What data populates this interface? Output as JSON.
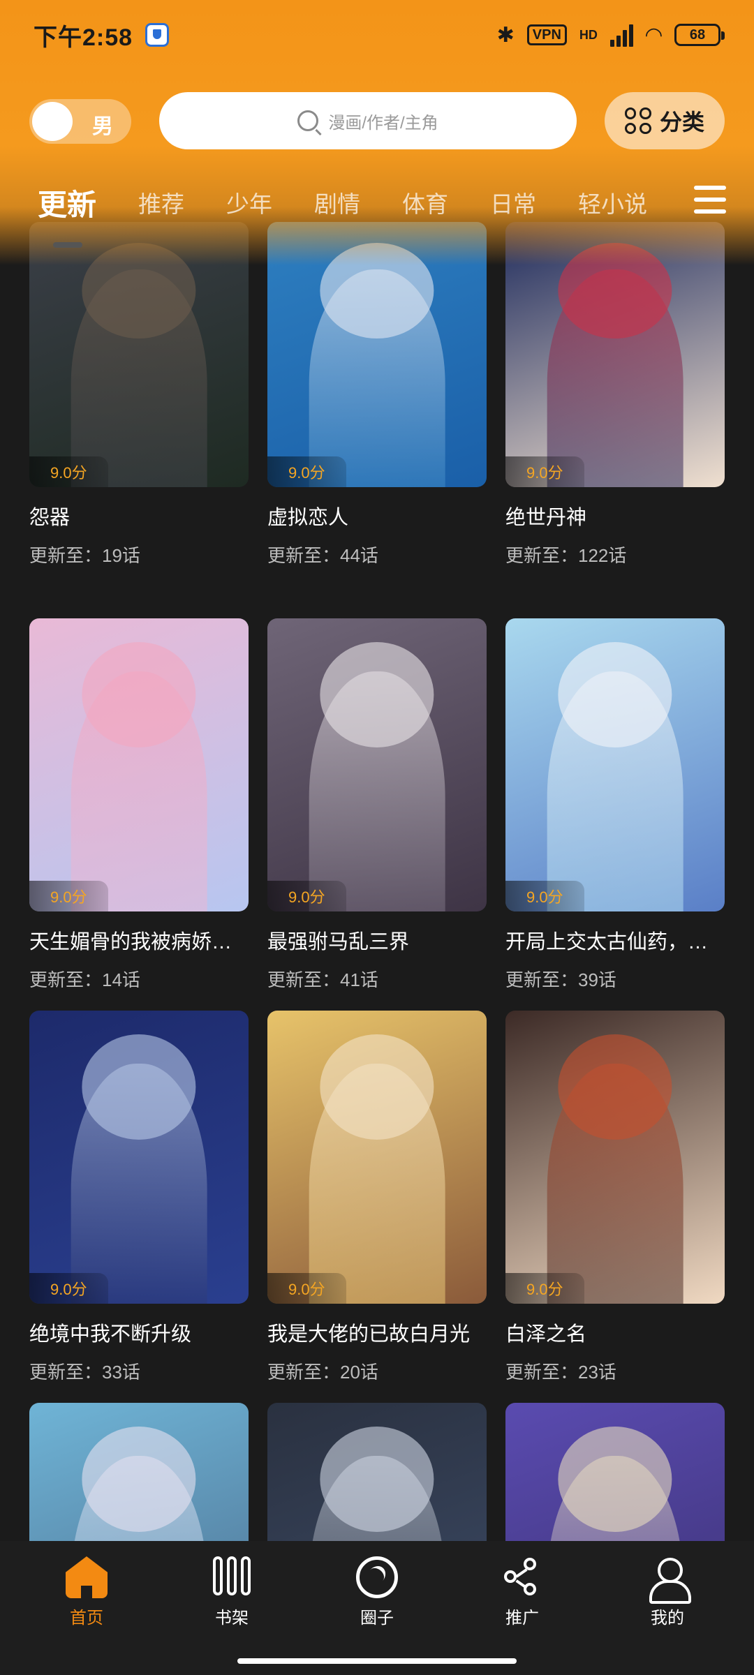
{
  "status_bar": {
    "time": "下午2:58",
    "bluetooth_glyph": "✱",
    "vpn": "VPN",
    "network": "HD",
    "wifi_glyph": "◠",
    "battery": "68"
  },
  "header": {
    "gender_label": "男",
    "search_placeholder": "漫画/作者/主角",
    "category_label": "分类"
  },
  "tabs": [
    "更新",
    "推荐",
    "少年",
    "剧情",
    "体育",
    "日常",
    "轻小说"
  ],
  "comics": [
    {
      "title": "怨器",
      "update": "更新至：19话",
      "rating": "9.0分",
      "colors": [
        "#3b3f48",
        "#6b5c4d",
        "#1e2a22"
      ]
    },
    {
      "title": "虚拟恋人",
      "update": "更新至：44话",
      "rating": "9.0分",
      "colors": [
        "#2e7fc0",
        "#dfe6f2",
        "#1a5fa8"
      ]
    },
    {
      "title": "绝世丹神",
      "update": "更新至：122话",
      "rating": "9.0分",
      "colors": [
        "#1d2a5c",
        "#c9324a",
        "#f0e0d0"
      ]
    },
    {
      "title": "天生媚骨的我被病娇…",
      "update": "更新至：14话",
      "rating": "9.0分",
      "colors": [
        "#e9b9d6",
        "#f4a6c0",
        "#b7c6f0"
      ]
    },
    {
      "title": "最强驸马乱三界",
      "update": "更新至：41话",
      "rating": "9.0分",
      "colors": [
        "#6f6577",
        "#e8e2e6",
        "#3e3445"
      ]
    },
    {
      "title": "开局上交太古仙药，…",
      "update": "更新至：39话",
      "rating": "9.0分",
      "colors": [
        "#a9d8ee",
        "#f1f3f8",
        "#5a7fc7"
      ]
    },
    {
      "title": "绝境中我不断升级",
      "update": "更新至：33话",
      "rating": "9.0分",
      "colors": [
        "#1d2a6b",
        "#b8c8e6",
        "#2a3f8f"
      ]
    },
    {
      "title": "我是大佬的已故白月光",
      "update": "更新至：20话",
      "rating": "9.0分",
      "colors": [
        "#e7c36a",
        "#f4e2c6",
        "#8a5a3a"
      ]
    },
    {
      "title": "白泽之名",
      "update": "更新至：23话",
      "rating": "9.0分",
      "colors": [
        "#3c2a26",
        "#c4502e",
        "#f0d9c2"
      ]
    },
    {
      "title": "",
      "update": "",
      "rating": "",
      "colors": [
        "#6fb4d6",
        "#e6e1f0",
        "#4a6b8c"
      ]
    },
    {
      "title": "",
      "update": "",
      "rating": "",
      "colors": [
        "#2a3140",
        "#cfd6e2",
        "#3d4c68"
      ]
    },
    {
      "title": "",
      "update": "",
      "rating": "",
      "colors": [
        "#5a4bb0",
        "#e8dcc0",
        "#3a3070"
      ]
    }
  ],
  "bottom_nav": [
    {
      "label": "首页",
      "icon": "home-icon",
      "active": true
    },
    {
      "label": "书架",
      "icon": "bookshelf-icon",
      "active": false
    },
    {
      "label": "圈子",
      "icon": "circle-icon",
      "active": false
    },
    {
      "label": "推广",
      "icon": "share-icon",
      "active": false
    },
    {
      "label": "我的",
      "icon": "profile-icon",
      "active": false
    }
  ],
  "colors": {
    "accent": "#f39418",
    "nav_active": "#f38a12",
    "background": "#1b1b1b",
    "rating": "#f5a623"
  }
}
